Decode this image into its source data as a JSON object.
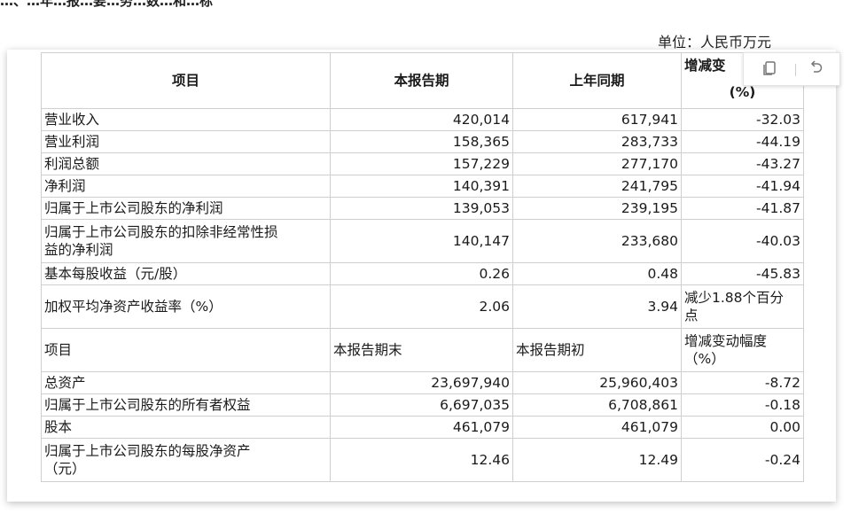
{
  "page_header_clip": "…、…年…报…要…务…数…和…标",
  "unit_label": "单位：人民币万元",
  "table": {
    "header1": {
      "item": "项目",
      "current": "本报告期",
      "prior": "上年同期",
      "change_line1": "增减变",
      "change_line2": "(%)"
    },
    "section1_rows": [
      {
        "label": "营业收入",
        "current": "420,014",
        "prior": "617,941",
        "change": "-32.03"
      },
      {
        "label": "营业利润",
        "current": "158,365",
        "prior": "283,733",
        "change": "-44.19"
      },
      {
        "label": "利润总额",
        "current": "157,229",
        "prior": "277,170",
        "change": "-43.27"
      },
      {
        "label": "净利润",
        "current": "140,391",
        "prior": "241,795",
        "change": "-41.94"
      },
      {
        "label": "归属于上市公司股东的净利润",
        "current": "139,053",
        "prior": "239,195",
        "change": "-41.87"
      },
      {
        "label_line1": "归属于上市公司股东的扣除非经常性损",
        "label_line2": "益的净利润",
        "current": "140,147",
        "prior": "233,680",
        "change": "-40.03"
      },
      {
        "label": "基本每股收益（元/股）",
        "current": "0.26",
        "prior": "0.48",
        "change": "-45.83"
      },
      {
        "label": "加权平均净资产收益率（%）",
        "current": "2.06",
        "prior": "3.94",
        "change_line1": "减少1.88个百分",
        "change_line2": "点"
      }
    ],
    "header2": {
      "item": "项目",
      "current": "本报告期末",
      "prior": "本报告期初",
      "change_line1": "增减变动幅度",
      "change_line2": "（%）"
    },
    "section2_rows": [
      {
        "label": "总资产",
        "current": "23,697,940",
        "prior": "25,960,403",
        "change": "-8.72"
      },
      {
        "label": "归属于上市公司股东的所有者权益",
        "current": "6,697,035",
        "prior": "6,708,861",
        "change": "-0.18"
      },
      {
        "label": "股本",
        "current": "461,079",
        "prior": "461,079",
        "change": "0.00"
      },
      {
        "label_line1": "归属于上市公司股东的每股净资产",
        "label_line2": "（元）",
        "current": "12.46",
        "prior": "12.49",
        "change": "-0.24"
      }
    ]
  },
  "toolbar": {
    "copy_icon": "copy-icon",
    "undo_icon": "undo-icon"
  },
  "colors": {
    "border": "#cfcfcf",
    "text": "#1a1a1a",
    "icon": "#777777"
  }
}
